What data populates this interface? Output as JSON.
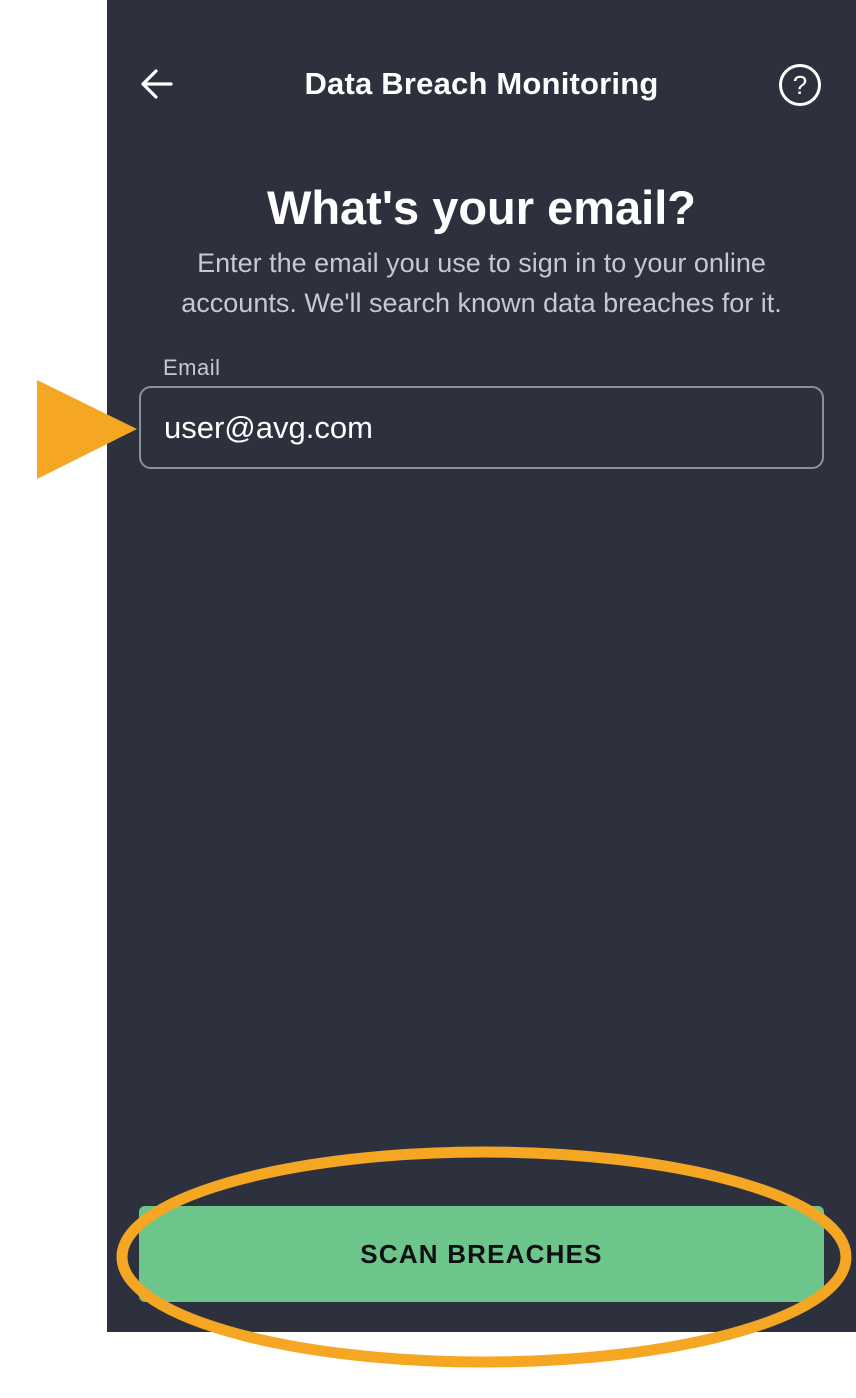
{
  "header": {
    "back_icon": "arrow-left-icon",
    "title": "Data Breach Monitoring",
    "help_icon": "question-circle-icon"
  },
  "content": {
    "heading": "What's your email?",
    "subtitle": "Enter the email you use to sign in to your online accounts. We'll search known data breaches for it."
  },
  "email_field": {
    "label": "Email",
    "value": "user@avg.com"
  },
  "scan_button": {
    "label": "SCAN BREACHES"
  },
  "colors": {
    "background": "#2c313d",
    "accent_green": "#6cc68c",
    "annotation_orange": "#f5a623"
  }
}
